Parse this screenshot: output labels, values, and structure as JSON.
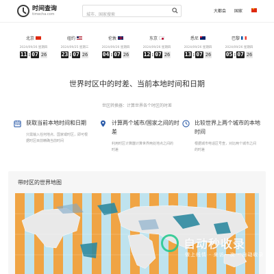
{
  "header": {
    "logo_title": "时间查询",
    "logo_sub": "timecha.com",
    "search_placeholder": "城市、国家搜索",
    "city_menu": "大都会",
    "country_menu": "国家"
  },
  "clocks": [
    {
      "city": "北京",
      "flag": "cn",
      "date": "2024/09/26 星期四",
      "hh": "11",
      "mm": "07",
      "ss": "26"
    },
    {
      "city": "纽约",
      "flag": "us",
      "date": "2024/09/25 星期三",
      "hh": "23",
      "mm": "07",
      "ss": "26"
    },
    {
      "city": "伦敦",
      "flag": "gb",
      "date": "2024/09/26 星期四",
      "hh": "04",
      "mm": "07",
      "ss": "26"
    },
    {
      "city": "东京",
      "flag": "jp",
      "date": "2024/09/26 星期四",
      "hh": "12",
      "mm": "07",
      "ss": "26"
    },
    {
      "city": "悉尼",
      "flag": "au",
      "date": "2024/09/26 星期四",
      "hh": "13",
      "mm": "07",
      "ss": "26"
    },
    {
      "city": "巴黎",
      "flag": "fr",
      "date": "2024/09/26 星期四",
      "hh": "05",
      "mm": "07",
      "ss": "26"
    }
  ],
  "hero": {
    "title": "世界时区中的时差、当前本地时间和日期",
    "subtitle": "世区转换器：计算世界各个时区的时差"
  },
  "features": [
    {
      "icon": "calendar-icon",
      "title": "获取当前本地时间和日期",
      "desc": "只需输入任何地点、国家或时区，即可根据时区目前精确当前时间"
    },
    {
      "icon": "location-pin-icon",
      "title": "计算两个城市/国家之间的时差",
      "desc": "利用时区计算器计算世界两处地点之间的时差"
    },
    {
      "icon": "clock-icon",
      "title": "比较世界上两个城市的本地时间",
      "desc": "根据城市电话区号查，对比两个城市之间的时差"
    }
  ],
  "map": {
    "title": "带时区的世界地图"
  },
  "watermark": {
    "text": "自动秒收录",
    "sub": "做上线情 · 来访一次 · 自动收录"
  },
  "colors": {
    "accent": "#2a5aa8",
    "map_ocean": "#bfe3ee",
    "map_orange": "#f3a13b",
    "map_land": "#e9e9e9",
    "map_teal": "#2f8aa0",
    "watermark_green": "#1ec88c"
  }
}
